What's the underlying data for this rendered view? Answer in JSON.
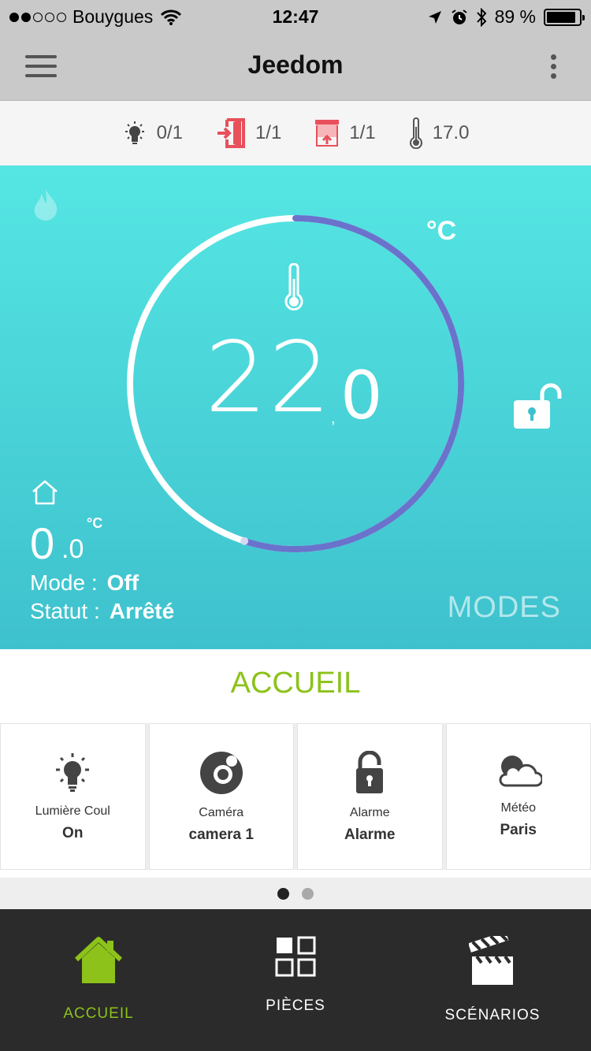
{
  "status_bar": {
    "signal_dots_filled": 2,
    "signal_dots_total": 5,
    "carrier": "Bouygues",
    "time": "12:47",
    "battery_text": "89 %",
    "battery_level": 0.89
  },
  "app_bar": {
    "title": "Jeedom"
  },
  "summary": [
    {
      "icon": "light-bulb-icon",
      "value": "0/1",
      "color": "#444444"
    },
    {
      "icon": "door-enter-icon",
      "value": "1/1",
      "color": "#e8505b"
    },
    {
      "icon": "shutter-icon",
      "value": "1/1",
      "color": "#e8505b"
    },
    {
      "icon": "thermometer-icon",
      "value": "17.0",
      "color": "#555555"
    }
  ],
  "thermostat": {
    "setpoint_integer": "22",
    "setpoint_separator": ",",
    "setpoint_decimal": "0",
    "unit": "°C",
    "dial_progress": 0.55,
    "outdoor_integer": "0",
    "outdoor_decimal": ".0",
    "outdoor_unit": "°C",
    "mode_label": "Mode :",
    "mode_value": "Off",
    "status_label": "Statut :",
    "status_value": "Arrêté",
    "modes_button": "MODES",
    "colors": {
      "gradient_top": "#55e6e3",
      "gradient_bottom": "#3ec1cd",
      "ring_active": "#6a72cc",
      "ring_inactive": "#ffffff"
    }
  },
  "room": {
    "title": "ACCUEIL",
    "tiles": [
      {
        "icon": "light-bulb-icon",
        "name": "Lumière Coul",
        "value": "On"
      },
      {
        "icon": "camera-eye-icon",
        "name": "Caméra",
        "value": "camera 1"
      },
      {
        "icon": "padlock-open-icon",
        "name": "Alarme",
        "value": "Alarme"
      },
      {
        "icon": "weather-cloud-icon",
        "name": "Météo",
        "value": "Paris"
      }
    ],
    "pager_pages": 2,
    "pager_active": 1
  },
  "bottom_nav": [
    {
      "icon": "home-icon",
      "label": "ACCUEIL",
      "active": true
    },
    {
      "icon": "grid-rooms-icon",
      "label": "PIÈCES",
      "active": false
    },
    {
      "icon": "clapperboard-icon",
      "label": "SCÉNARIOS",
      "active": false
    }
  ],
  "accent_color": "#8cc21a"
}
